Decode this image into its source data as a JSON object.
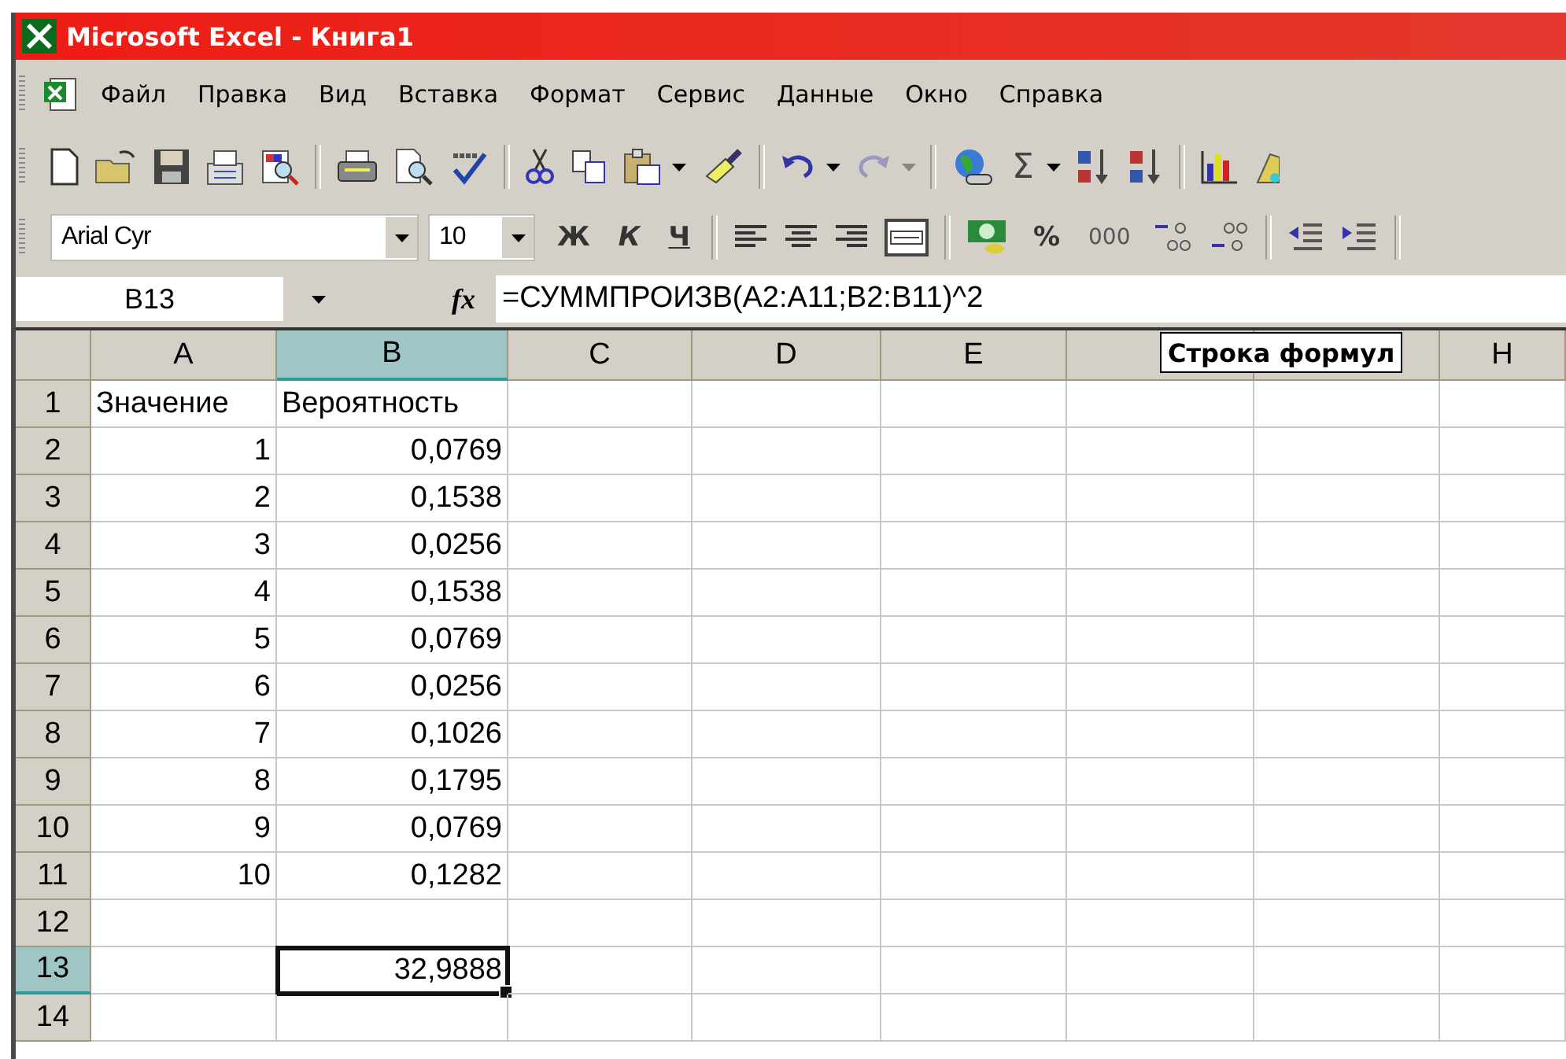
{
  "window": {
    "title": "Microsoft Excel - Книга1"
  },
  "menu": [
    {
      "label": "Файл"
    },
    {
      "label": "Правка"
    },
    {
      "label": "Вид"
    },
    {
      "label": "Вставка"
    },
    {
      "label": "Формат"
    },
    {
      "label": "Сервис"
    },
    {
      "label": "Данные"
    },
    {
      "label": "Окно"
    },
    {
      "label": "Справка"
    }
  ],
  "standard_toolbar": [
    {
      "kind": "new"
    },
    {
      "kind": "open"
    },
    {
      "kind": "save"
    },
    {
      "kind": "permission"
    },
    {
      "kind": "research"
    },
    {
      "kind": "separator"
    },
    {
      "kind": "print"
    },
    {
      "kind": "preview"
    },
    {
      "kind": "spelling"
    },
    {
      "kind": "separator"
    },
    {
      "kind": "cut"
    },
    {
      "kind": "copy"
    },
    {
      "kind": "paste",
      "dropdown": true
    },
    {
      "kind": "painter"
    },
    {
      "kind": "separator"
    },
    {
      "kind": "undo",
      "dropdown": true,
      "disabled": false
    },
    {
      "kind": "redo",
      "dropdown": true,
      "disabled": true
    },
    {
      "kind": "separator"
    },
    {
      "kind": "hyperlink"
    },
    {
      "kind": "sum",
      "label": "Σ",
      "dropdown": true
    },
    {
      "kind": "sort-asc"
    },
    {
      "kind": "sort-desc"
    },
    {
      "kind": "separator"
    },
    {
      "kind": "chart"
    },
    {
      "kind": "drawing"
    }
  ],
  "formatting_toolbar": {
    "font": "Arial Cyr",
    "size": "10",
    "buttons": [
      {
        "kind": "bold",
        "label": "Ж"
      },
      {
        "kind": "italic",
        "label": "К"
      },
      {
        "kind": "underline",
        "label": "Ч"
      },
      {
        "kind": "separator"
      },
      {
        "kind": "align-left"
      },
      {
        "kind": "align-center"
      },
      {
        "kind": "align-right"
      },
      {
        "kind": "merge"
      },
      {
        "kind": "separator"
      },
      {
        "kind": "currency"
      },
      {
        "kind": "percent",
        "label": "%"
      },
      {
        "kind": "thousands",
        "label": "000"
      },
      {
        "kind": "inc-decimal"
      },
      {
        "kind": "dec-decimal"
      },
      {
        "kind": "separator"
      },
      {
        "kind": "outdent"
      },
      {
        "kind": "indent"
      },
      {
        "kind": "separator"
      }
    ]
  },
  "formula_bar": {
    "name_box": "B13",
    "function_label": "fx",
    "formula": "=СУММПРОИЗВ(A2:A11;B2:B11)^2"
  },
  "tooltip": "Строка формул",
  "columns": [
    {
      "label": "A",
      "selected": false
    },
    {
      "label": "B",
      "selected": true
    },
    {
      "label": "C",
      "selected": false
    },
    {
      "label": "D",
      "selected": false
    },
    {
      "label": "E",
      "selected": false
    },
    {
      "selected": false
    },
    {
      "selected": false
    },
    {
      "label": "H",
      "selected": false
    }
  ],
  "rows": [
    {
      "number": "1",
      "selected": false,
      "cells": [
        {
          "kind": "text",
          "text": "Значение"
        },
        {
          "kind": "text",
          "text": "Вероятность"
        }
      ]
    },
    {
      "number": "2",
      "selected": false,
      "cells": [
        {
          "kind": "number",
          "text": "1"
        },
        {
          "kind": "number",
          "text": "0,0769"
        }
      ]
    },
    {
      "number": "3",
      "selected": false,
      "cells": [
        {
          "kind": "number",
          "text": "2"
        },
        {
          "kind": "number",
          "text": "0,1538"
        }
      ]
    },
    {
      "number": "4",
      "selected": false,
      "cells": [
        {
          "kind": "number",
          "text": "3"
        },
        {
          "kind": "number",
          "text": "0,0256"
        }
      ]
    },
    {
      "number": "5",
      "selected": false,
      "cells": [
        {
          "kind": "number",
          "text": "4"
        },
        {
          "kind": "number",
          "text": "0,1538"
        }
      ]
    },
    {
      "number": "6",
      "selected": false,
      "cells": [
        {
          "kind": "number",
          "text": "5"
        },
        {
          "kind": "number",
          "text": "0,0769"
        }
      ]
    },
    {
      "number": "7",
      "selected": false,
      "cells": [
        {
          "kind": "number",
          "text": "6"
        },
        {
          "kind": "number",
          "text": "0,0256"
        }
      ]
    },
    {
      "number": "8",
      "selected": false,
      "cells": [
        {
          "kind": "number",
          "text": "7"
        },
        {
          "kind": "number",
          "text": "0,1026"
        }
      ]
    },
    {
      "number": "9",
      "selected": false,
      "cells": [
        {
          "kind": "number",
          "text": "8"
        },
        {
          "kind": "number",
          "text": "0,1795"
        }
      ]
    },
    {
      "number": "10",
      "selected": false,
      "cells": [
        {
          "kind": "number",
          "text": "9"
        },
        {
          "kind": "number",
          "text": "0,0769"
        }
      ]
    },
    {
      "number": "11",
      "selected": false,
      "cells": [
        {
          "kind": "number",
          "text": "10"
        },
        {
          "kind": "number",
          "text": "0,1282"
        }
      ]
    },
    {
      "number": "12",
      "selected": false,
      "cells": []
    },
    {
      "number": "13",
      "selected": true,
      "cells": [
        {
          "kind": "empty"
        },
        {
          "kind": "number",
          "text": "32,9888",
          "active": true
        }
      ]
    },
    {
      "number": "14",
      "selected": false,
      "cells": []
    }
  ]
}
